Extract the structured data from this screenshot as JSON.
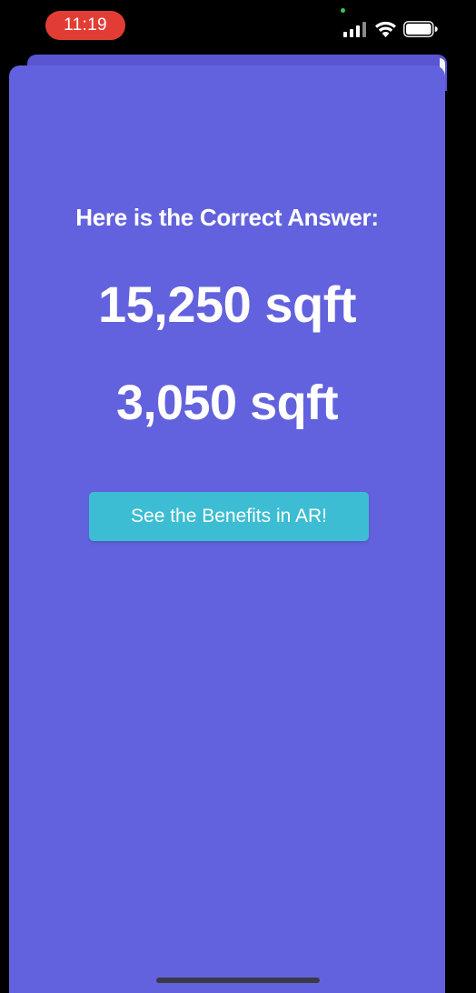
{
  "status_bar": {
    "time": "11:19",
    "icons": [
      "signal-icon",
      "wifi-icon",
      "battery-icon"
    ],
    "time_pill_color": "#e23d35"
  },
  "answer": {
    "heading": "Here is the Correct Answer:",
    "primary_value": "15,250 sqft",
    "secondary_value": "3,050 sqft"
  },
  "actions": {
    "ar_button_label": "See the Benefits in AR!"
  },
  "colors": {
    "background": "#6262de",
    "button": "#3cbdd3",
    "text": "#ffffff"
  }
}
